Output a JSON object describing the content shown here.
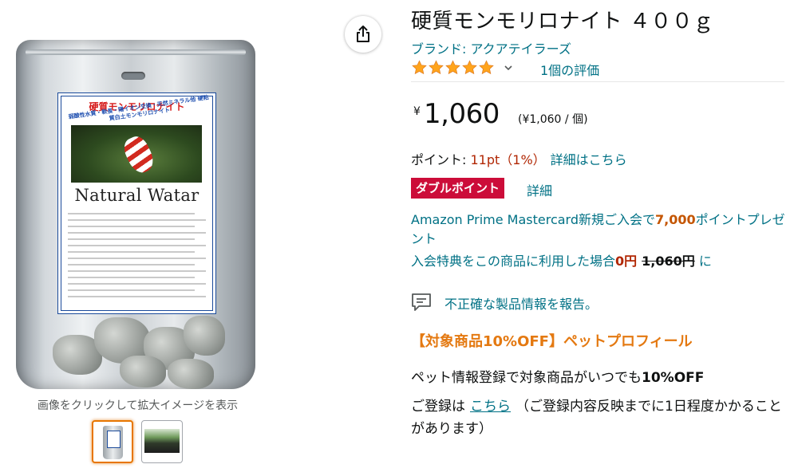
{
  "product": {
    "title": "硬質モンモリロナイト ４００ｇ",
    "brand": "ブランド: アクアテイラーズ",
    "rating_stars": 5,
    "ratings_count": "1個の評価",
    "price_symbol": "¥",
    "price": "1,060",
    "unit_price": "(¥1,060 / 個)"
  },
  "points": {
    "label": "ポイント: ",
    "value": "11pt（1%）",
    "link": "詳細はこちら"
  },
  "double_point": {
    "badge": "ダブルポイント",
    "detail": "詳細"
  },
  "card_offer": {
    "text_before": "Amazon Prime Mastercard新規ご入会で",
    "amount": "7,000",
    "text_after": "ポイントプレゼント",
    "line2_prefix": "入会特典をこの商品に利用した場合",
    "line2_zero": "0円",
    "line2_original": "1,060円",
    "line2_suffix": " に"
  },
  "report": {
    "text": "不正確な製品情報を報告。"
  },
  "promo": {
    "heading": "【対象商品10%OFF】ペットプロフィール",
    "line1_prefix": "ペット情報登録で対象商品がいつでも",
    "line1_bold": "10%OFF",
    "line2_prefix": "ご登録は",
    "line2_link": "こちら",
    "line2_suffix": "（ご登録内容反映までに1日程度かかることがあります）"
  },
  "image": {
    "caption": "画像をクリックして拡大イメージを表示",
    "label_title": "硬質モンモリロナイト",
    "label_subtitle": "弱酸性水質・軟長・陽イオン交換・天然ミネラル他 硬粘質白土モンモリロナイト",
    "label_brand": "Natural Watar"
  },
  "colors": {
    "link": "#007185",
    "star": "#ffa41c",
    "price_red": "#b12704",
    "badge_red": "#cc0c39",
    "promo_orange": "#e47911"
  }
}
